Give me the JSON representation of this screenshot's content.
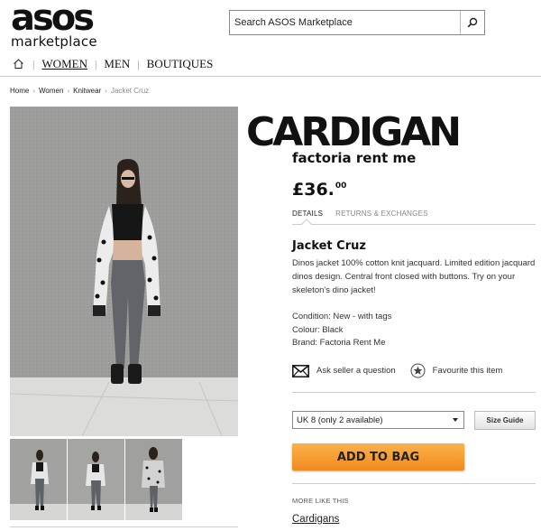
{
  "logo": {
    "main": "asos",
    "sub": "marketplace"
  },
  "search": {
    "placeholder": "Search ASOS Marketplace",
    "icon": "search-icon"
  },
  "nav": {
    "home_icon": "home-icon",
    "items": [
      {
        "label": "WOMEN",
        "active": true
      },
      {
        "label": "MEN"
      },
      {
        "label": "BOUTIQUES"
      }
    ]
  },
  "breadcrumb": [
    "Home",
    "Women",
    "Knitwear",
    "Jacket Cruz"
  ],
  "shop": {
    "title": "CARDIGAN",
    "subtitle": "factoria rent me"
  },
  "product": {
    "price_main": "£36.",
    "price_pence": "00",
    "tabs": [
      "DETAILS",
      "RETURNS & EXCHANGES"
    ],
    "title": "Jacket Cruz",
    "description": "Dinos jacket 100% cotton knit jacquard. Limited edition jacquard dinos design. Central front closed with buttons. Try on your skeleton's dino jacket!",
    "condition": "Condition: New - with tags",
    "colour": "Colour: Black",
    "brand": "Brand: Factoria Rent Me",
    "ask_seller": "Ask seller a question",
    "favourite": "Favourite this item",
    "size_selected": "UK 8 (only 2 available)",
    "size_guide": "Size Guide",
    "add_to_bag": "ADD TO BAG",
    "more_like_this": "MORE LIKE THIS",
    "more_link": "Cardigans"
  },
  "colors": {
    "button_orange": "#f49a2f",
    "text": "#222222",
    "rule": "#cccccc"
  }
}
